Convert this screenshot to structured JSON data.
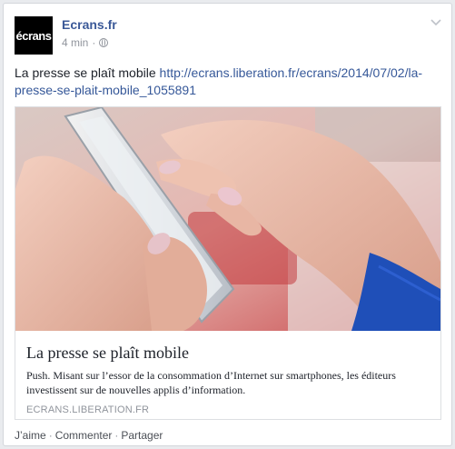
{
  "post": {
    "page_name": "Ecrans.fr",
    "avatar_text": "écrans",
    "time": "4 min",
    "privacy_icon": "globe-icon",
    "menu_icon": "chevron-down-icon",
    "text": "La presse se plaît mobile",
    "link_url": "http://ecrans.liberation.fr/ecrans/2014/07/02/la-presse-se-plait-mobile_1055891"
  },
  "link_preview": {
    "title": "La presse se plaît mobile",
    "description": "Push. Misant sur l’essor de la consommation d’Internet sur smartphones, les éditeurs investissent sur de nouvelles applis d’information.",
    "domain": "ECRANS.LIBERATION.FR"
  },
  "actions": {
    "like": "J’aime",
    "comment": "Commenter",
    "share": "Partager",
    "separator": "·"
  }
}
